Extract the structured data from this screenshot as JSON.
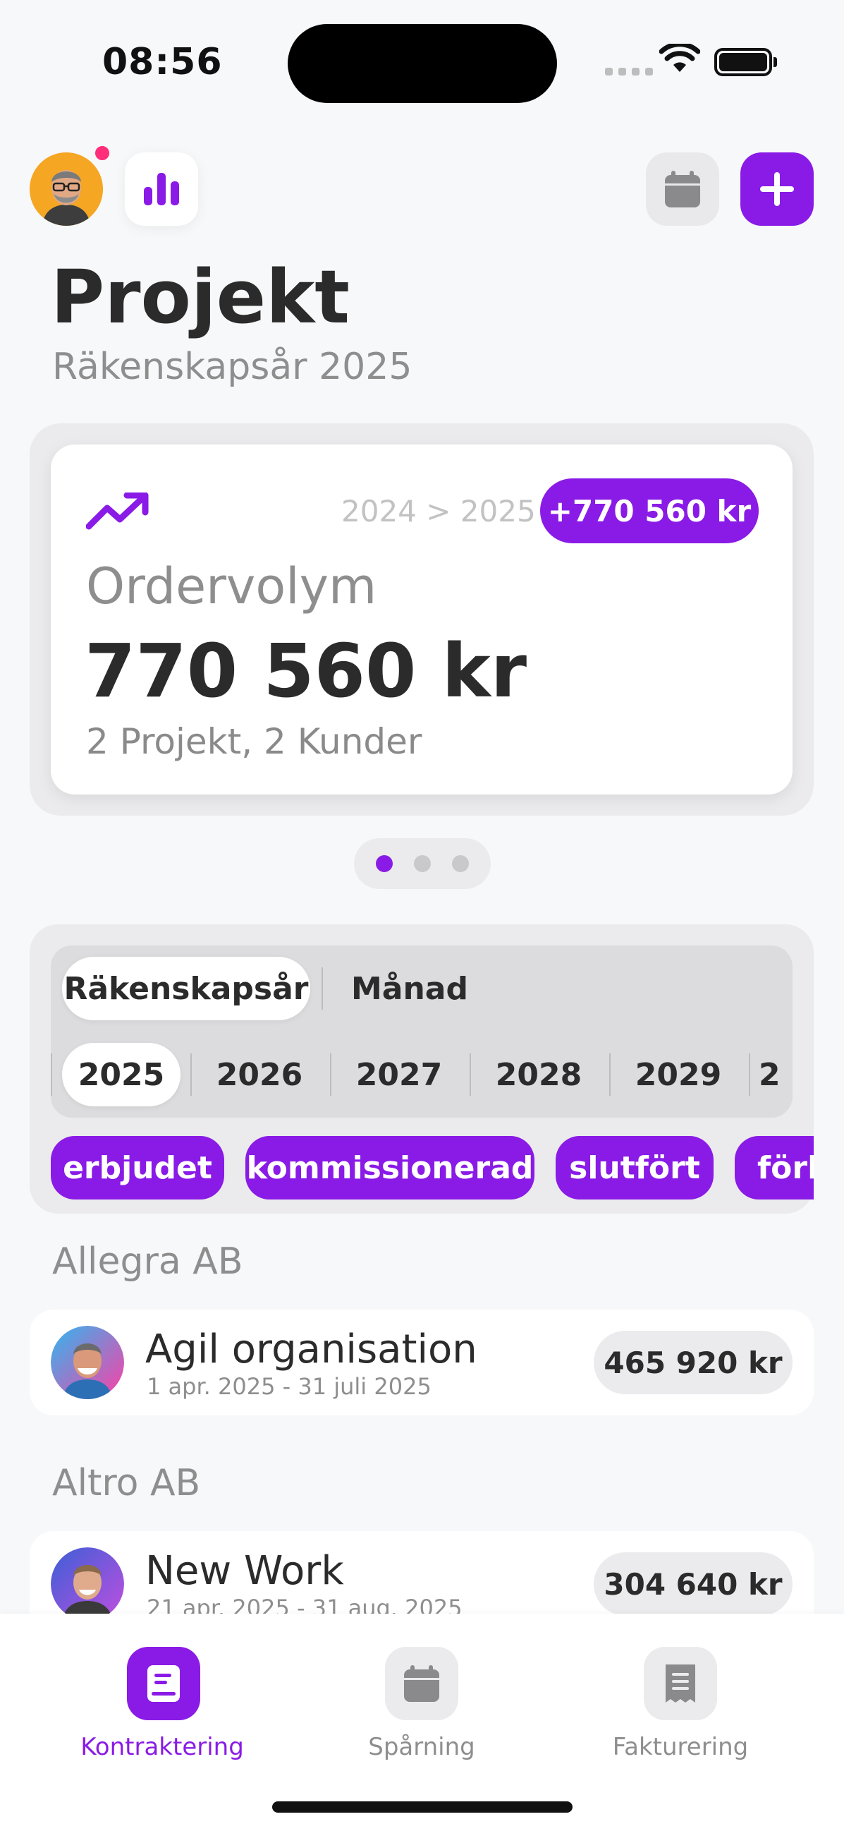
{
  "status_bar": {
    "time": "08:56"
  },
  "header": {
    "avatar": "user-avatar",
    "stats_icon": "bar-chart-icon",
    "calendar_icon": "calendar-icon",
    "add_icon": "plus-icon",
    "title": "Projekt",
    "subtitle": "Räkenskapsår 2025"
  },
  "summary_card": {
    "trend_icon": "trend-up-icon",
    "comparison": "2024 > 2025",
    "delta": "+770 560 kr",
    "label": "Ordervolym",
    "value": "770 560 kr",
    "meta": "2 Projekt, 2 Kunder",
    "page_count": 3,
    "active_page": 1
  },
  "filters": {
    "period_tabs": [
      {
        "label": "Räkenskapsår",
        "selected": true
      },
      {
        "label": "Månad",
        "selected": false
      }
    ],
    "years": [
      {
        "label": "2025",
        "selected": true
      },
      {
        "label": "2026",
        "selected": false
      },
      {
        "label": "2027",
        "selected": false
      },
      {
        "label": "2028",
        "selected": false
      },
      {
        "label": "2029",
        "selected": false
      },
      {
        "label": "2",
        "selected": false
      }
    ],
    "status_chips": [
      "erbjudet",
      "kommissionerad",
      "slutfört",
      "förl"
    ]
  },
  "groups": [
    {
      "customer": "Allegra AB",
      "projects": [
        {
          "title": "Agil organisation",
          "dates": "1 apr. 2025 - 31 juli 2025",
          "amount": "465 920 kr"
        }
      ]
    },
    {
      "customer": "Altro AB",
      "projects": [
        {
          "title": "New Work",
          "dates": "21 apr. 2025 - 31 aug. 2025",
          "amount": "304 640 kr"
        }
      ]
    }
  ],
  "tabbar": {
    "items": [
      {
        "label": "Kontraktering",
        "icon": "contract-icon",
        "active": true
      },
      {
        "label": "Spårning",
        "icon": "calendar-icon",
        "active": false
      },
      {
        "label": "Fakturering",
        "icon": "receipt-icon",
        "active": false
      }
    ]
  },
  "colors": {
    "accent": "#8a1be6",
    "notification": "#ff2d7a",
    "background": "#f7f8fa",
    "muted_text": "#8e8e8e"
  }
}
